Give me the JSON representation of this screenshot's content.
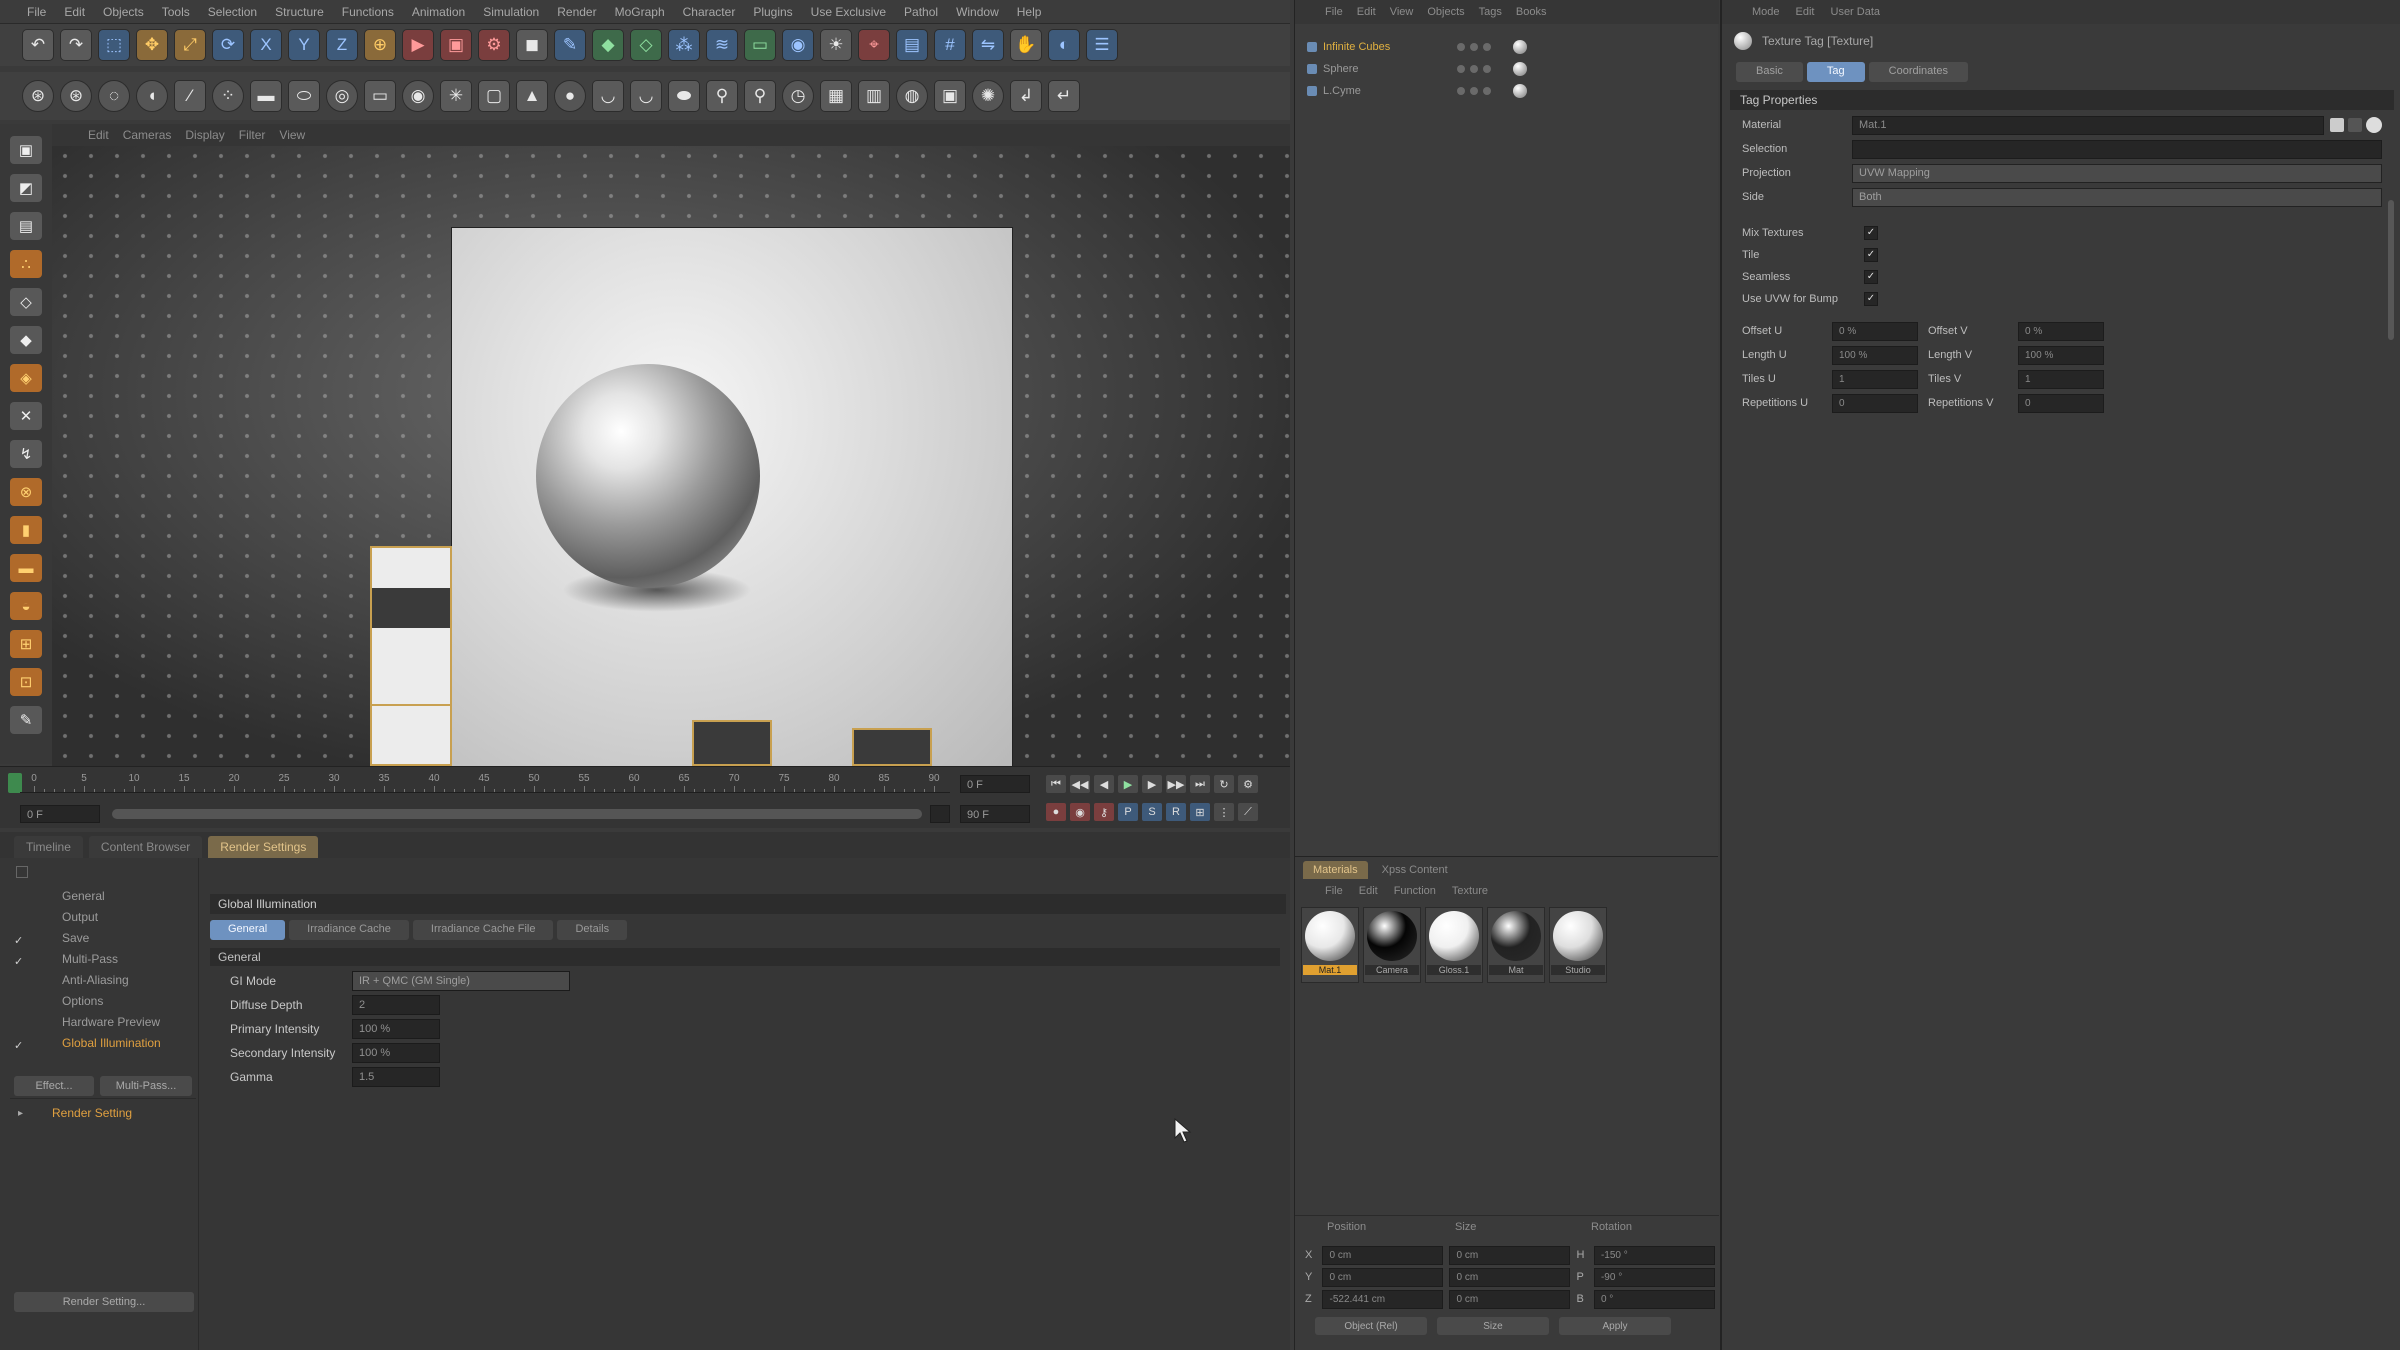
{
  "menubar": {
    "items": [
      "File",
      "Edit",
      "Objects",
      "Tools",
      "Selection",
      "Structure",
      "Functions",
      "Animation",
      "Simulation",
      "Render",
      "MoGraph",
      "Character",
      "Plugins",
      "Use Exclusive",
      "Pathol",
      "Window",
      "Help"
    ]
  },
  "viewport": {
    "menu": [
      "Edit",
      "Cameras",
      "Display",
      "Filter",
      "View"
    ]
  },
  "timeline": {
    "ticks": [
      "0",
      "5",
      "10",
      "15",
      "20",
      "25",
      "30",
      "35",
      "40",
      "45",
      "50",
      "55",
      "60",
      "65",
      "70",
      "75",
      "80",
      "85",
      "90"
    ],
    "current_frame": "0 F",
    "start_frame": "0 F",
    "end_frame": "90 F",
    "max_frame": "90 F"
  },
  "bottom_tabs": [
    "Timeline",
    "Content Browser",
    "Render Settings"
  ],
  "render_settings": {
    "items": [
      {
        "label": "General",
        "checked": false,
        "active": false
      },
      {
        "label": "Output",
        "checked": false,
        "active": false
      },
      {
        "label": "Save",
        "checked": true,
        "active": false
      },
      {
        "label": "Multi-Pass",
        "checked": true,
        "active": false
      },
      {
        "label": "Anti-Aliasing",
        "checked": false,
        "active": false
      },
      {
        "label": "Options",
        "checked": false,
        "active": false
      },
      {
        "label": "Hardware Preview",
        "checked": false,
        "active": false
      },
      {
        "label": "Global Illumination",
        "checked": true,
        "active": true
      }
    ],
    "effect_button": "Effect...",
    "multipass_button": "Multi-Pass...",
    "setting_name": "Render Setting",
    "setting_button": "Render Setting..."
  },
  "gi": {
    "title": "Global Illumination",
    "tabs": [
      "General",
      "Irradiance Cache",
      "Irradiance Cache File",
      "Details"
    ],
    "section": "General",
    "rows": [
      {
        "label": "GI Mode",
        "value": "IR + QMC (GM Single)"
      },
      {
        "label": "Diffuse Depth",
        "value": "2"
      },
      {
        "label": "Primary Intensity",
        "value": "100 %"
      },
      {
        "label": "Secondary Intensity",
        "value": "100 %"
      },
      {
        "label": "Gamma",
        "value": "1.5"
      }
    ]
  },
  "object_manager": {
    "menu": [
      "File",
      "Edit",
      "View",
      "Objects",
      "Tags",
      "Books"
    ],
    "objects": [
      {
        "name": "Infinite Cubes",
        "active": true
      },
      {
        "name": "Sphere",
        "active": false
      },
      {
        "name": "L.Cyme",
        "active": false
      }
    ]
  },
  "material_manager": {
    "tabs": [
      "Materials",
      "Xpss Content"
    ],
    "menu": [
      "File",
      "Edit",
      "Function",
      "Texture"
    ],
    "materials": [
      {
        "name": "Mat.1",
        "color": "#e8e8e8",
        "active": true
      },
      {
        "name": "Camera",
        "color": "#050505",
        "active": false
      },
      {
        "name": "Gloss.1",
        "color": "#f0f0f0",
        "active": false
      },
      {
        "name": "Mat",
        "color": "#222222",
        "active": false
      },
      {
        "name": "Studio",
        "color": "#dedede",
        "active": false
      }
    ]
  },
  "coordinates": {
    "headers": [
      "Position",
      "Size",
      "Rotation"
    ],
    "rows": [
      {
        "axis": "X",
        "pos": "0 cm",
        "size": "0 cm",
        "rot_axis": "H",
        "rot": "-150 °"
      },
      {
        "axis": "Y",
        "pos": "0 cm",
        "size": "0 cm",
        "rot_axis": "P",
        "rot": "-90 °"
      },
      {
        "axis": "Z",
        "pos": "-522.441 cm",
        "size": "0 cm",
        "rot_axis": "B",
        "rot": "0 °"
      }
    ],
    "buttons": [
      "Object (Rel)",
      "Size",
      "Apply"
    ]
  },
  "attributes": {
    "menu": [
      "Mode",
      "Edit",
      "User Data"
    ],
    "title": "Texture Tag [Texture]",
    "tabs": [
      "Basic",
      "Tag",
      "Coordinates"
    ],
    "section": "Tag Properties",
    "material_label": "Material",
    "material_value": "Mat.1",
    "selection_label": "Selection",
    "selection_value": "",
    "projection_label": "Projection",
    "projection_value": "UVW Mapping",
    "side_label": "Side",
    "side_value": "Both",
    "checks": [
      {
        "label": "Mix Textures",
        "value": "✓"
      },
      {
        "label": "Tile",
        "value": "✓"
      },
      {
        "label": "Seamless",
        "value": "✓"
      },
      {
        "label": "Use UVW for Bump",
        "value": "✓"
      }
    ],
    "pairs": [
      {
        "l1": "Offset U",
        "v1": "0 %",
        "l2": "Offset V",
        "v2": "0 %"
      },
      {
        "l1": "Length U",
        "v1": "100 %",
        "l2": "Length V",
        "v2": "100 %"
      },
      {
        "l1": "Tiles U",
        "v1": "1",
        "l2": "Tiles V",
        "v2": "1"
      },
      {
        "l1": "Repetitions U",
        "v1": "0",
        "l2": "Repetitions V",
        "v2": "0"
      }
    ]
  },
  "colors": {
    "accent_orange": "#e0a040",
    "tab_blue": "#6e92c0"
  }
}
